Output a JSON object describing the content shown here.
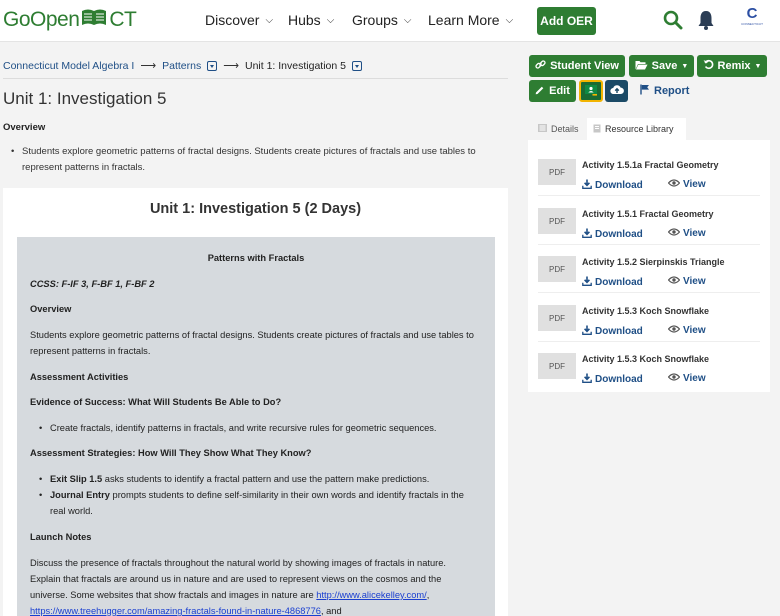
{
  "header": {
    "logo_go": "Go",
    "logo_open": "Open",
    "logo_ct": "CT",
    "nav": [
      {
        "label": "Discover"
      },
      {
        "label": "Hubs"
      },
      {
        "label": "Groups"
      },
      {
        "label": "Learn More"
      }
    ],
    "add_oer_label": "Add OER",
    "avatar_letter": "C",
    "avatar_text": "CONNECTICUT"
  },
  "breadcrumb": {
    "items": [
      "Connecticut Model Algebra I",
      "Patterns",
      "Unit 1: Investigation 5"
    ]
  },
  "page": {
    "title": "Unit 1: Investigation 5",
    "overview_heading": "Overview",
    "overview_text": "Students explore geometric patterns of fractal designs. Students create pictures of fractals and use tables to represent patterns in fractals."
  },
  "content": {
    "title": "Unit 1: Investigation 5 (2 Days)",
    "subtitle": "Patterns with Fractals",
    "ccss": "CCSS:  F-IF 3, F-BF 1, F-BF 2",
    "overview_heading": "Overview",
    "overview_line1": "Students explore geometric patterns of fractal designs. Students create pictures of fractals and use tables to",
    "overview_line2": "represent patterns in fractals.",
    "assessment_heading": "Assessment Activities",
    "evidence_heading": "Evidence of Success: What Will Students Be Able to Do?",
    "evidence_item": "Create fractals, identify patterns in fractals, and write recursive rules for geometric sequences.",
    "strategies_heading": "Assessment Strategies: How Will They Show What They Know?",
    "exit_bold": "Exit Slip 1.5",
    "exit_rest": " asks students to identify a fractal pattern and use the pattern make predictions.",
    "journal_bold": "Journal Entry",
    "journal_rest": " prompts students to define self-similarity in their own words and identify fractals in the",
    "journal_line2": "real world.",
    "launch_heading": "Launch Notes",
    "launch_line1": "Discuss the presence of fractals throughout the natural world by showing images of fractals in nature.",
    "launch_line2": "Explain that fractals are around us in nature and are used to represent views on the cosmos and the",
    "launch_line3": "universe. Some websites that show fractals and images in nature are ",
    "link1": "http://www.alicekelley.com/",
    "link1_after": ",",
    "link2": "https://www.treehugger.com/amazing-fractals-found-in-nature-4868776",
    "link2_after": ", and"
  },
  "actions": {
    "student_view": "Student View",
    "save": "Save",
    "remix": "Remix",
    "edit": "Edit",
    "report": "Report"
  },
  "tabs": {
    "details": "Details",
    "library": "Resource Library"
  },
  "resources": {
    "badge": "PDF",
    "download_label": "Download",
    "view_label": "View",
    "items": [
      {
        "name": "Activity 1.5.1a Fractal Geometry"
      },
      {
        "name": "Activity 1.5.1 Fractal Geometry"
      },
      {
        "name": "Activity 1.5.2 Sierpinskis Triangle"
      },
      {
        "name": "Activity 1.5.3 Koch Snowflake"
      },
      {
        "name": "Activity 1.5.3 Koch Snowflake"
      }
    ]
  },
  "colors": {
    "brand_green": "#2e7d32",
    "link_blue": "#1f4f86",
    "navy": "#1b4a66"
  }
}
